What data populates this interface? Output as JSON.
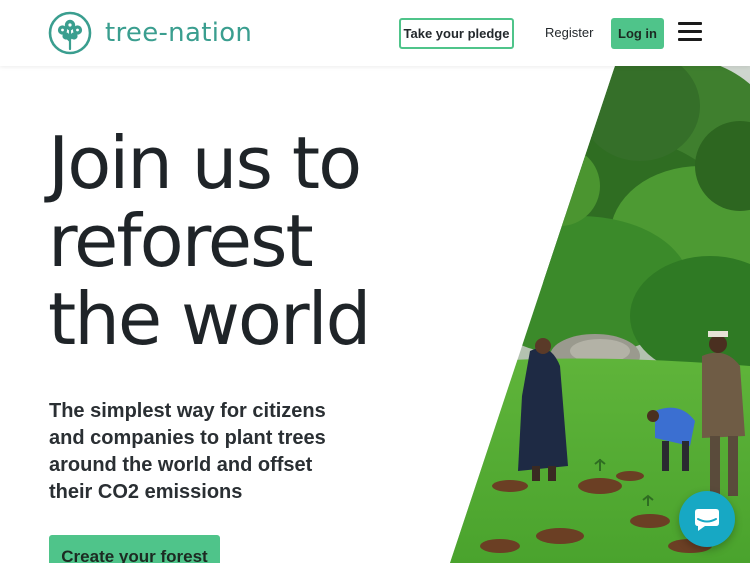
{
  "header": {
    "brand": "tree-nation",
    "pledge_label": "Take your pledge",
    "register_label": "Register",
    "login_label": "Log in"
  },
  "hero": {
    "title_lines": [
      "Join us to",
      "reforest",
      "the world"
    ],
    "subtitle": "The simplest way for citizens and companies to plant trees around the world and offset their CO2 emissions",
    "cta_label": "Create your forest"
  },
  "colors": {
    "brand_teal": "#3a9e8f",
    "accent_green": "#4fc48a",
    "chat_blue": "#17a8c4"
  },
  "icons": {
    "menu": "hamburger-menu-icon",
    "chat": "chat-bubble-icon",
    "logo": "tree-logo-icon"
  }
}
